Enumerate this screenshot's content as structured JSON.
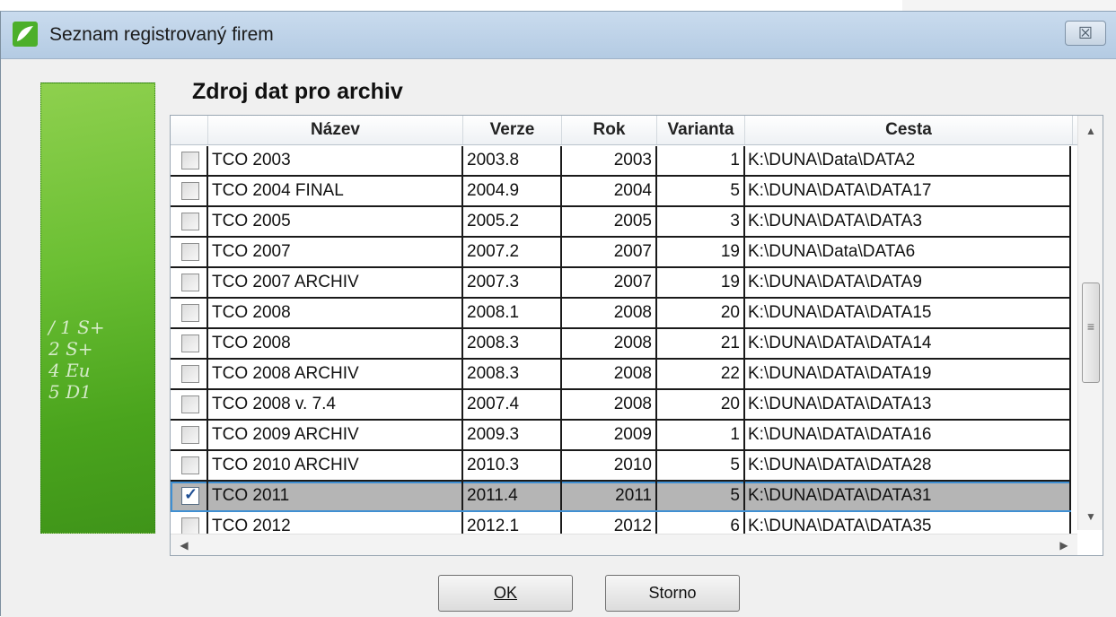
{
  "window": {
    "title": "Seznam registrovaný firem",
    "close_glyph": "☒"
  },
  "content": {
    "heading": "Zdroj dat pro archiv"
  },
  "sidebar_image": {
    "description_icon": "decorative-green-banner",
    "glyph_text": "/ 1 S+\n2 S+\n4 Eu\n5 D1"
  },
  "table": {
    "columns": [
      "Název",
      "Verze",
      "Rok",
      "Varianta",
      "Cesta"
    ],
    "rows": [
      {
        "checked": false,
        "name": "TCO 2003",
        "verze": "2003.8",
        "rok": "2003",
        "varianta": "1",
        "cesta": "K:\\DUNA\\Data\\DATA2"
      },
      {
        "checked": false,
        "name": "TCO 2004 FINAL",
        "verze": "2004.9",
        "rok": "2004",
        "varianta": "5",
        "cesta": "K:\\DUNA\\DATA\\DATA17"
      },
      {
        "checked": false,
        "name": "TCO 2005",
        "verze": "2005.2",
        "rok": "2005",
        "varianta": "3",
        "cesta": "K:\\DUNA\\DATA\\DATA3"
      },
      {
        "checked": false,
        "name": "TCO 2007",
        "verze": "2007.2",
        "rok": "2007",
        "varianta": "19",
        "cesta": "K:\\DUNA\\Data\\DATA6"
      },
      {
        "checked": false,
        "name": "TCO 2007 ARCHIV",
        "verze": "2007.3",
        "rok": "2007",
        "varianta": "19",
        "cesta": "K:\\DUNA\\DATA\\DATA9"
      },
      {
        "checked": false,
        "name": "TCO 2008",
        "verze": "2008.1",
        "rok": "2008",
        "varianta": "20",
        "cesta": "K:\\DUNA\\DATA\\DATA15"
      },
      {
        "checked": false,
        "name": "TCO 2008",
        "verze": "2008.3",
        "rok": "2008",
        "varianta": "21",
        "cesta": "K:\\DUNA\\DATA\\DATA14"
      },
      {
        "checked": false,
        "name": "TCO 2008 ARCHIV",
        "verze": "2008.3",
        "rok": "2008",
        "varianta": "22",
        "cesta": "K:\\DUNA\\DATA\\DATA19"
      },
      {
        "checked": false,
        "name": "TCO 2008 v. 7.4",
        "verze": "2007.4",
        "rok": "2008",
        "varianta": "20",
        "cesta": "K:\\DUNA\\DATA\\DATA13"
      },
      {
        "checked": false,
        "name": "TCO 2009 ARCHIV",
        "verze": "2009.3",
        "rok": "2009",
        "varianta": "1",
        "cesta": "K:\\DUNA\\DATA\\DATA16"
      },
      {
        "checked": false,
        "name": "TCO 2010 ARCHIV",
        "verze": "2010.3",
        "rok": "2010",
        "varianta": "5",
        "cesta": "K:\\DUNA\\DATA\\DATA28"
      },
      {
        "checked": true,
        "name": "TCO 2011",
        "verze": "2011.4",
        "rok": "2011",
        "varianta": "5",
        "cesta": "K:\\DUNA\\DATA\\DATA31"
      },
      {
        "checked": false,
        "name": "TCO 2012",
        "verze": "2012.1",
        "rok": "2012",
        "varianta": "6",
        "cesta": "K:\\DUNA\\DATA\\DATA35"
      }
    ],
    "selected_row": 11
  },
  "scrollbars": {
    "up_arrow": "▲",
    "down_arrow": "▼",
    "left_arrow": "◀",
    "right_arrow": "▶",
    "thumb_grip": "≡"
  },
  "buttons": {
    "ok_label": "OK",
    "cancel_label": "Storno"
  },
  "colors": {
    "titlebar": "#c9dbee",
    "selection_bg": "#b5b5b5",
    "selection_outline": "#3f8fd2",
    "banner_green": "#6bbf33"
  }
}
